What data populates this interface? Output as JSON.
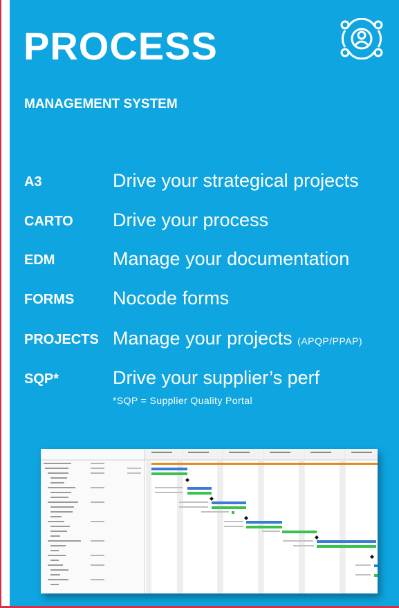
{
  "header": {
    "title": "PROCESS",
    "subtitle": "MANAGEMENT SYSTEM",
    "logo_icon": "user-target-icon"
  },
  "modules": [
    {
      "key": "A3",
      "description": "Drive your strategical projects"
    },
    {
      "key": "CARTO",
      "description": "Drive your process"
    },
    {
      "key": "EDM",
      "description": "Manage your documentation"
    },
    {
      "key": "FORMS",
      "description": "Nocode forms"
    },
    {
      "key": "PROJECTS",
      "description": "Manage your projects",
      "note": "(APQP/PPAP)"
    },
    {
      "key": "SQP*",
      "description": "Drive your supplier’s perf"
    }
  ],
  "footnote": "*SQP = Supplier Quality Portal",
  "colors": {
    "background": "#0ea5e0",
    "accent_border": "#d9304a",
    "gantt_blue": "#3a7bd5",
    "gantt_green": "#3cc24a",
    "gantt_orange": "#e58a1f"
  }
}
